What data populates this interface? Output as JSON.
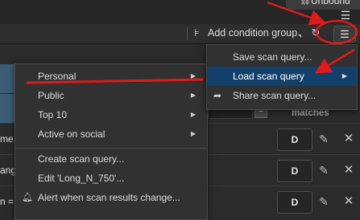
{
  "top": {
    "unbound_label": "Unbound",
    "unbound_icon": "link-icon",
    "list_icon": "list-icon"
  },
  "toolbar": {
    "add_condition_group_label": "Add condition group",
    "add_condition_group_icon": "condition-group-icon",
    "extra_icon": "refresh-icon",
    "menu_icon": "list-menu-icon"
  },
  "table": {
    "column_matches": "matches",
    "minus_label": "−",
    "row_fragments": [
      "me",
      "ang",
      "n ="
    ],
    "d_labels": [
      "D",
      "D",
      "D"
    ]
  },
  "left_menu": {
    "items": [
      {
        "label": "Personal",
        "submenu": true
      },
      {
        "label": "Public",
        "submenu": true
      },
      {
        "label": "Top 10",
        "submenu": true
      },
      {
        "label": "Active on social",
        "submenu": true
      },
      {
        "label": "Create scan query...",
        "submenu": false
      },
      {
        "label": "Edit 'Long_N_750'...",
        "submenu": false
      },
      {
        "label": "Alert when scan results change...",
        "submenu": false,
        "icon": "bell-icon"
      }
    ]
  },
  "right_menu": {
    "items": [
      {
        "label": "Save scan query...",
        "submenu": false
      },
      {
        "label": "Load scan query",
        "submenu": true,
        "selected": true
      },
      {
        "label": "Share scan query...",
        "submenu": false,
        "icon": "share-icon"
      }
    ]
  },
  "colors": {
    "selected_bg": "#13406b",
    "annotation_red": "#e01a1a",
    "thumb_blue": "#3b5d78"
  }
}
